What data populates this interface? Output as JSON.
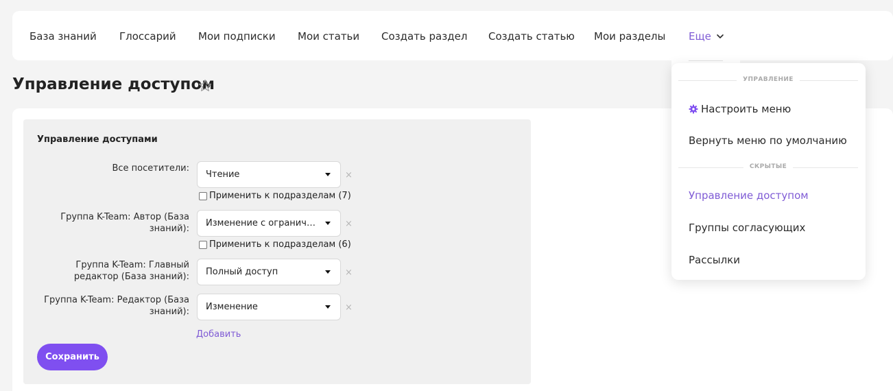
{
  "nav": {
    "items": [
      {
        "label": "База знаний"
      },
      {
        "label": "Глоссарий"
      },
      {
        "label": "Мои подписки"
      },
      {
        "label": "Мои статьи"
      },
      {
        "label": "Создать раздел"
      },
      {
        "label": "Создать статью"
      },
      {
        "label": "Мои разделы"
      }
    ],
    "more_label": "Еще"
  },
  "page": {
    "title": "Управление доступом"
  },
  "access": {
    "heading": "Управление доступами",
    "rows": [
      {
        "label": "Все посетители:",
        "value": "Чтение",
        "apply_label": "Применить к подразделам (7)"
      },
      {
        "label": "Группа K-Team: Автор (База знаний):",
        "value": "Изменение с ограничениями",
        "apply_label": "Применить к подразделам (6)"
      },
      {
        "label": "Группа K-Team: Главный редактор (База знаний):",
        "value": "Полный доступ"
      },
      {
        "label": "Группа K-Team: Редактор (База знаний):",
        "value": "Изменение"
      }
    ],
    "remove_symbol": "×",
    "add_label": "Добавить",
    "save_label": "Сохранить"
  },
  "dropdown": {
    "section_manage": "УПРАВЛЕНИЕ",
    "configure_menu": "Настроить меню",
    "reset_menu": "Вернуть меню по умолчанию",
    "section_hidden": "СКРЫТЫЕ",
    "hidden_items": [
      {
        "label": "Управление доступом"
      },
      {
        "label": "Группы согласующих"
      },
      {
        "label": "Рассылки"
      }
    ]
  },
  "colors": {
    "accent": "#7f5bd5",
    "button": "#7f4ff0",
    "panel": "#f0f0f0",
    "background": "#f4f4f4"
  },
  "icons": {
    "more_chevron": "chevron-down-icon",
    "favorite": "star-outline-icon",
    "configure": "gear-icon",
    "select_arrow": "caret-down-icon",
    "remove": "close-icon"
  }
}
